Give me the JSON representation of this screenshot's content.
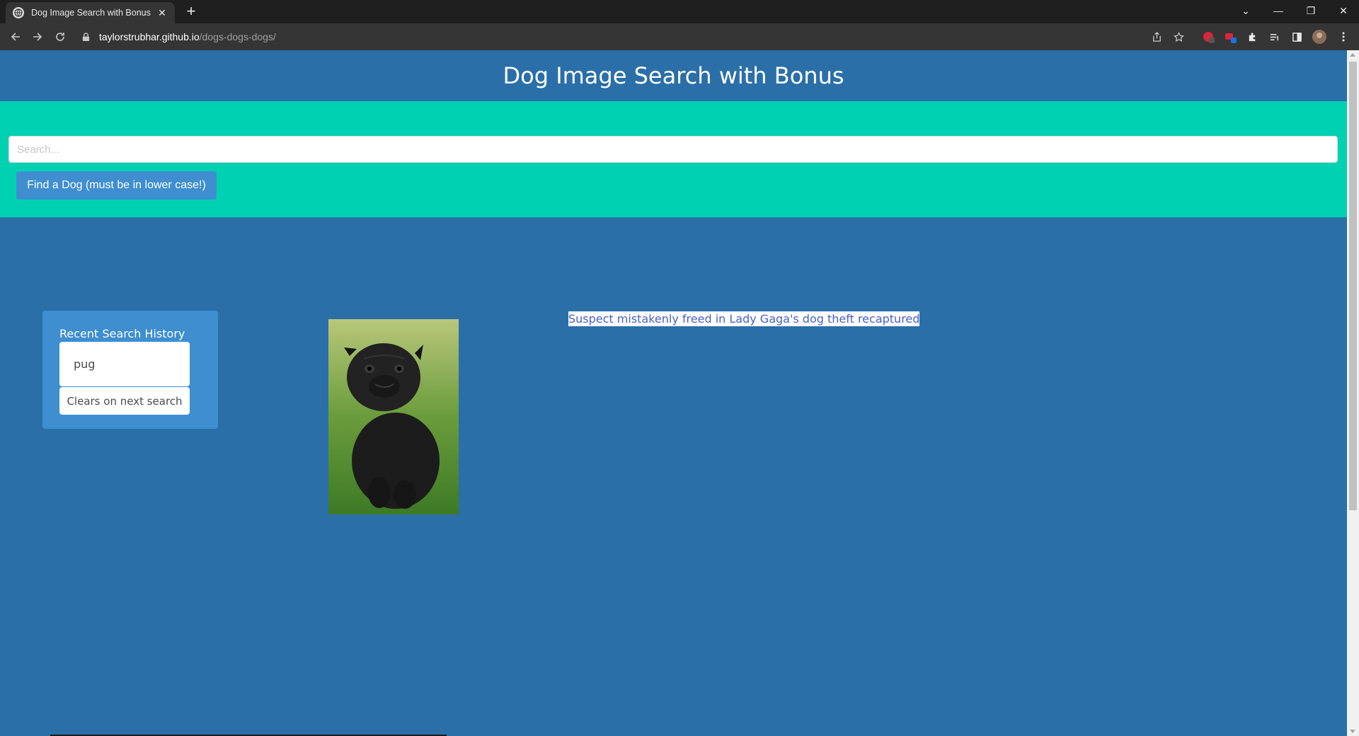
{
  "browser": {
    "tab_title": "Dog Image Search with Bonus",
    "new_tab_symbol": "+",
    "url_host": "taylorstrubhar.github.io",
    "url_path": "/dogs-dogs-dogs/"
  },
  "page": {
    "title": "Dog Image Search with Bonus",
    "search": {
      "placeholder": "Search...",
      "value": ""
    },
    "find_button_label": "Find a Dog (must be in lower case!)",
    "history": {
      "heading": "Recent Search History",
      "items": [
        "pug"
      ],
      "hint": "Clears on next search"
    },
    "news_headline": "Suspect mistakenly freed in Lady Gaga's dog theft recaptured",
    "result_image_alt": "pug"
  },
  "colors": {
    "page_bg": "#2a6fa8",
    "hero_bg": "#00d1b2",
    "button_bg": "#3e8ed0",
    "link": "#485fc7"
  }
}
